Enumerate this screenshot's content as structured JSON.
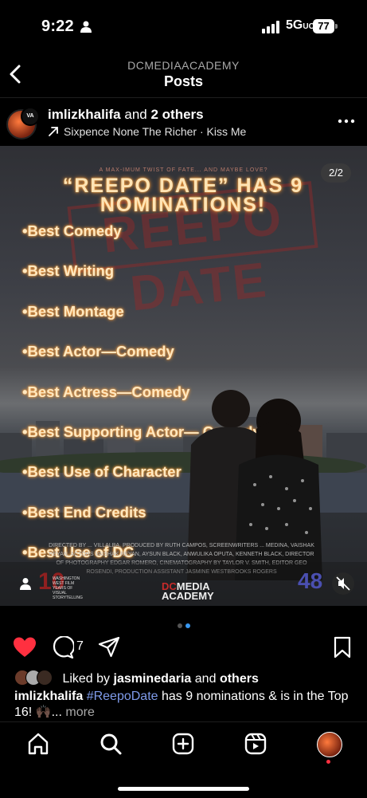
{
  "status_bar": {
    "time": "9:22",
    "network": "5G",
    "network_suffix": "UC",
    "battery": "77"
  },
  "header": {
    "account": "DCMEDIAACADEMY",
    "title": "Posts"
  },
  "post": {
    "username": "imlizkhalifa",
    "and": "and",
    "others": "2 others",
    "music": "Sixpence None The Richer · Kiss Me",
    "avatar_badge": "VA"
  },
  "media": {
    "counter": "2/2",
    "tagline": "A MAX-IMUM TWIST OF FATE... AND MAYBE LOVE?",
    "stamp": "REEPO DATE",
    "headline": "“REEPO DATE” HAS 9 NOMINATIONS!",
    "nominations": [
      "•Best Comedy",
      "•Best Writing",
      "•Best Montage",
      "•Best Actor—Comedy",
      "•Best Actress—Comedy",
      "•Best Supporting Actor— Comedy",
      "•Best Use of Character",
      "•Best End Credits",
      "•Best Use of DC"
    ],
    "credits": "DIRECTED BY ... VILLALBA, PRODUCED BY RUTH CAMPOS, SCREENWRITERS ... MEDINA, VAISHAK REYAN, ACTORS VAISHAK REYAN, AYSUN BLACK, ANWULIKA OPUTA, KENNETH BLACK, DIRECTOR OF PHOTOGRAPHY EDGAR ROMERO, CINEMATOGRAPHY BY TAYLOR V. SMITH, EDITOR GEO ROSENDI, PRODUCTION ASSISTANT JASMINE WESTBROOKS ROGERS",
    "logo_10": "10",
    "logo_10_sub": "WASHINGTON WEST FILM YEARS OF VISUAL STORYTELLING",
    "logo_dc_1": "DC",
    "logo_dc_2": "MEDIA",
    "logo_dc_3": "ACADEMY",
    "logo_48": "48"
  },
  "actions": {
    "comment_count": "7"
  },
  "likes": {
    "prefix": "Liked by",
    "user": "jasminedaria",
    "and": "and",
    "others": "others"
  },
  "caption": {
    "username": "imlizkhalifa",
    "hashtag": "#ReepoDate",
    "text": "has 9 nominations & is in the Top 16! 🙌🏿...",
    "more": "more"
  },
  "colors": {
    "accent": "#3897f0",
    "like": "#ff3040",
    "glow": "#ff9b3a",
    "hashtag": "#7f9bea"
  }
}
